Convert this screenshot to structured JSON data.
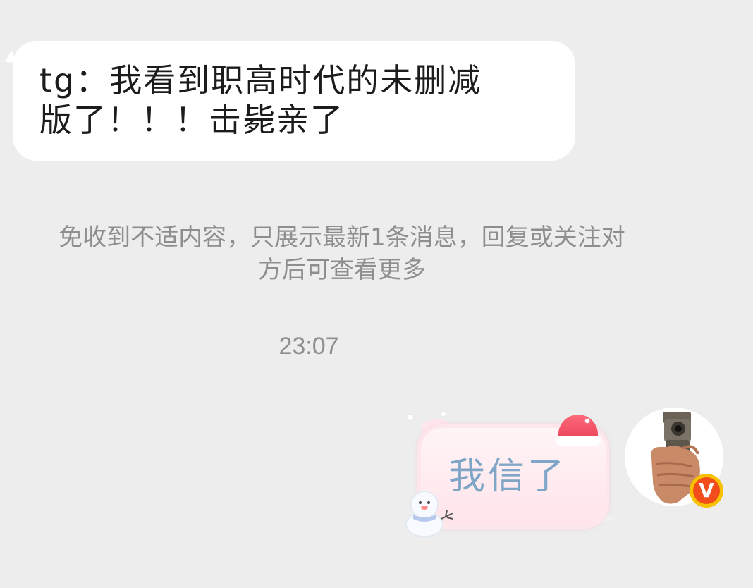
{
  "conversation": {
    "incoming_message": {
      "text_line1": "tg：我看到职高时代的未删减",
      "text_line2": "版了！！！击毙亲了"
    },
    "system_notice": {
      "line1": "免收到不适内容，只展示最新1条消息，回复或关注对",
      "line2": "方后可查看更多"
    },
    "timestamp": "23:07",
    "outgoing_message": {
      "text": "我信了",
      "bubble_style": "pink-cat-christmas-sticker"
    },
    "sender_avatar": {
      "icon": "hand-holding-pistol-icon",
      "badge_label": "V",
      "badge_color": "#f24d1a"
    }
  }
}
